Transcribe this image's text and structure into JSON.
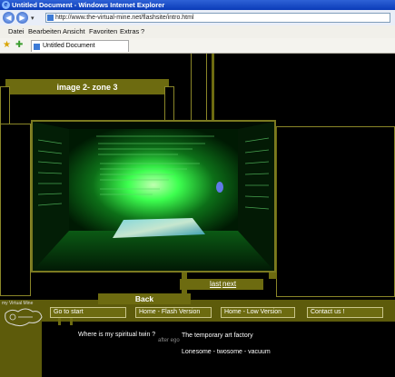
{
  "window": {
    "title": "Untitled Document - Windows Internet Explorer",
    "address": "http://www.the-virtual-mine.net/flashsite/intro.html"
  },
  "menu": [
    "Datei",
    "Bearbeiten",
    "Ansicht",
    "Favoriten",
    "Extras",
    "?"
  ],
  "tab": {
    "title": "Untitled Document"
  },
  "page": {
    "zone_label": "image 2- zone 3",
    "links": {
      "last": "last",
      "next": "next"
    },
    "back_label": "Back",
    "logo_text": "my Virtual Mine",
    "nav": [
      "Go to start",
      "Home - Flash Version",
      "Home - Low Version",
      "Contact us !"
    ],
    "bottom": {
      "spiritual": "Where is my spiritual twin ?",
      "after_ego": "after ego",
      "art_factory": "The temporary art factory",
      "lonesome": "Lonesome - twosome - vacuum"
    }
  },
  "colors": {
    "olive": "#6d6b10",
    "titlebar": "#0a3bb8",
    "glow": "#3dff4f"
  }
}
